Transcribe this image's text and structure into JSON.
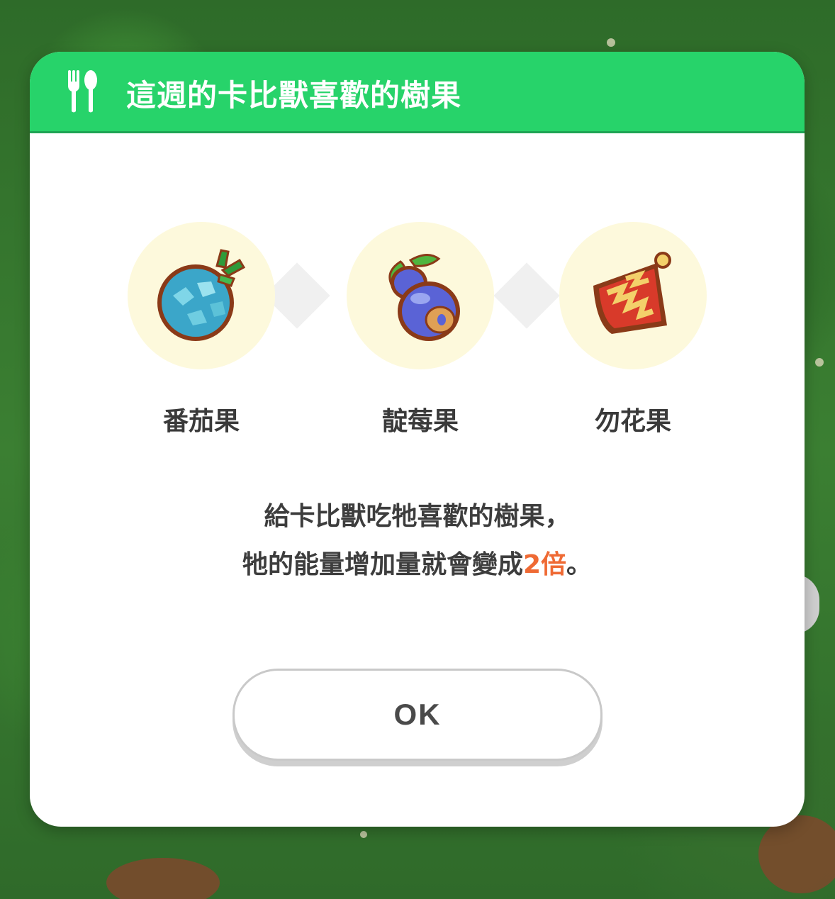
{
  "dialog": {
    "title": "這週的卡比獸喜歡的樹果",
    "title_icon": "fork-spoon-icon",
    "berries": [
      {
        "name": "番茄果",
        "icon": "tomato-berry-icon",
        "color": "#3ba6c9"
      },
      {
        "name": "靛莓果",
        "icon": "indigo-berry-icon",
        "color": "#5a63d6"
      },
      {
        "name": "勿花果",
        "icon": "figy-berry-icon",
        "color": "#d83a2a"
      }
    ],
    "message_line1": "給卡比獸吃牠喜歡的樹果，",
    "message_line2_prefix": "牠的能量增加量就會變成",
    "message_highlight": "2倍",
    "message_line2_suffix": "。",
    "ok_label": "OK"
  },
  "colors": {
    "header": "#27d36a",
    "highlight": "#ef6a34",
    "berry_bg": "#fdf9dc"
  }
}
